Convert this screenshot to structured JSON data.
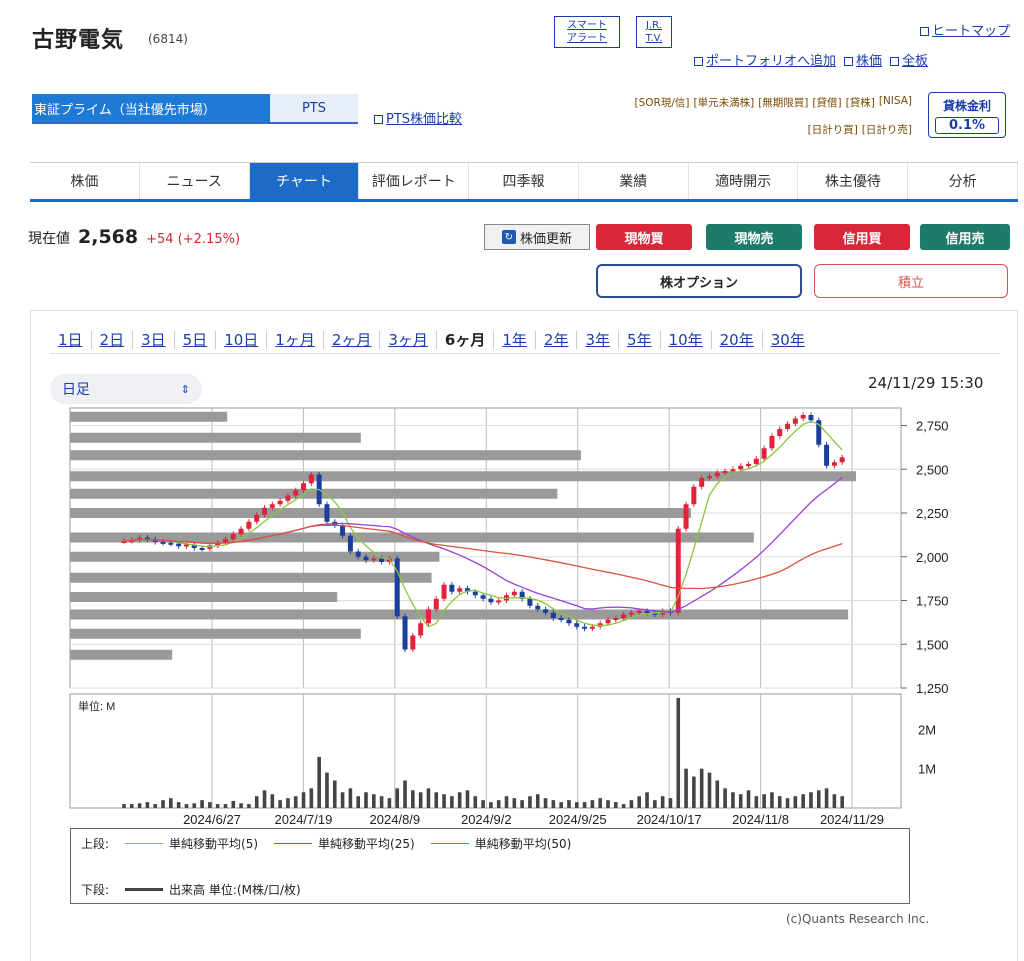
{
  "header": {
    "title": "古野電気",
    "code": "(6814)",
    "smart_alert_1": "スマート",
    "smart_alert_2": "アラート",
    "jrtv_1": "J.R.",
    "jrtv_2": "T.V.",
    "heatmap": "ヒートマップ",
    "portfolio_add": "ポートフォリオへ追加",
    "stock_price": "株価",
    "full_board": "全板"
  },
  "market": {
    "primary": "東証プライム（当社優先市場）",
    "pts": "PTS",
    "pts_compare": "PTS株価比較"
  },
  "tags": {
    "row1": [
      "[SOR現/信]",
      "[単元未満株]",
      "[無期限買]",
      "[貸借]",
      "[貸株]",
      "[NISA]"
    ],
    "row2": [
      "[日計り買]",
      "[日計り売]"
    ]
  },
  "lending": {
    "label": "貸株金利",
    "value": "0.1%"
  },
  "nav": {
    "tabs": [
      "株価",
      "ニュース",
      "チャート",
      "評価レポート",
      "四季報",
      "業績",
      "適時開示",
      "株主優待",
      "分析"
    ],
    "active_index": 2
  },
  "quote": {
    "label": "現在値",
    "price": "2,568",
    "change": "+54 (+2.15%)"
  },
  "actions": {
    "refresh": "株価更新",
    "cash_buy": "現物買",
    "cash_sell": "現物売",
    "margin_buy": "信用買",
    "margin_sell": "信用売",
    "option": "株オプション",
    "accumulate": "積立",
    "buy_color": "#d9273a",
    "sell_color": "#1e7a6a"
  },
  "periods": {
    "items": [
      "1日",
      "2日",
      "3日",
      "5日",
      "10日",
      "1ヶ月",
      "2ヶ月",
      "3ヶ月",
      "6ヶ月",
      "1年",
      "2年",
      "3年",
      "5年",
      "10年",
      "20年",
      "30年"
    ],
    "active_index": 8
  },
  "chart_controls": {
    "interval": "日足",
    "timestamp": "24/11/29 15:30",
    "volume_unit": "単位: M"
  },
  "chart_data": [
    {
      "type": "candlestick",
      "x_ticks": [
        "2024/6/27",
        "2024/7/19",
        "2024/8/9",
        "2024/9/2",
        "2024/9/25",
        "2024/10/17",
        "2024/11/8",
        "2024/11/29"
      ],
      "y_ticks": [
        "2,750",
        "2,500",
        "2,250",
        "2,000",
        "1,750",
        "1,500",
        "1,250"
      ],
      "ylim": [
        1250,
        2850
      ],
      "close": [
        2090,
        2095,
        2110,
        2100,
        2085,
        2080,
        2075,
        2060,
        2070,
        2050,
        2045,
        2065,
        2080,
        2100,
        2130,
        2160,
        2200,
        2240,
        2280,
        2300,
        2320,
        2350,
        2380,
        2420,
        2470,
        2300,
        2200,
        2180,
        2120,
        2030,
        2000,
        1980,
        1990,
        1970,
        1990,
        1660,
        1470,
        1550,
        1620,
        1700,
        1760,
        1840,
        1800,
        1820,
        1800,
        1780,
        1760,
        1740,
        1750,
        1780,
        1800,
        1760,
        1720,
        1700,
        1680,
        1650,
        1640,
        1620,
        1600,
        1590,
        1600,
        1620,
        1640,
        1650,
        1670,
        1680,
        1690,
        1680,
        1670,
        1690,
        1680,
        2160,
        2300,
        2400,
        2450,
        2460,
        2480,
        2490,
        2500,
        2520,
        2530,
        2560,
        2620,
        2690,
        2730,
        2760,
        2790,
        2810,
        2780,
        2640,
        2520,
        2540,
        2568
      ],
      "ma_colors": {
        "ma5": "#8cc63f",
        "ma25": "#9b3fd9",
        "ma50": "#e0503a"
      },
      "up_color": "#e0223a",
      "down_color": "#1c3f9e",
      "price_bands": [
        {
          "price": 2800,
          "width": 0.2
        },
        {
          "price": 2680,
          "width": 0.37
        },
        {
          "price": 2580,
          "width": 0.65
        },
        {
          "price": 2460,
          "width": 1.0
        },
        {
          "price": 2360,
          "width": 0.62
        },
        {
          "price": 2250,
          "width": 0.79
        },
        {
          "price": 2110,
          "width": 0.87
        },
        {
          "price": 2000,
          "width": 0.47
        },
        {
          "price": 1880,
          "width": 0.46
        },
        {
          "price": 1770,
          "width": 0.34
        },
        {
          "price": 1670,
          "width": 0.99
        },
        {
          "price": 1560,
          "width": 0.37
        },
        {
          "price": 1440,
          "width": 0.13
        }
      ]
    },
    {
      "type": "bar",
      "title": "単位: M",
      "y_ticks": [
        "2M",
        "1M"
      ],
      "ylim": [
        0,
        2.9
      ],
      "values": [
        0.1,
        0.1,
        0.12,
        0.15,
        0.1,
        0.2,
        0.25,
        0.15,
        0.1,
        0.12,
        0.2,
        0.15,
        0.1,
        0.1,
        0.18,
        0.12,
        0.1,
        0.3,
        0.45,
        0.35,
        0.2,
        0.25,
        0.3,
        0.4,
        0.5,
        1.3,
        0.9,
        0.7,
        0.4,
        0.5,
        0.3,
        0.4,
        0.35,
        0.3,
        0.25,
        0.5,
        0.7,
        0.45,
        0.4,
        0.5,
        0.4,
        0.35,
        0.3,
        0.4,
        0.45,
        0.3,
        0.2,
        0.15,
        0.2,
        0.3,
        0.25,
        0.2,
        0.3,
        0.35,
        0.25,
        0.2,
        0.15,
        0.2,
        0.15,
        0.15,
        0.2,
        0.25,
        0.2,
        0.15,
        0.1,
        0.2,
        0.3,
        0.4,
        0.2,
        0.3,
        0.25,
        2.8,
        1.0,
        0.8,
        1.0,
        0.9,
        0.7,
        0.5,
        0.4,
        0.35,
        0.45,
        0.3,
        0.35,
        0.4,
        0.3,
        0.25,
        0.3,
        0.35,
        0.4,
        0.45,
        0.5,
        0.35,
        0.3
      ],
      "color": "#444444"
    }
  ],
  "legend": {
    "upper_label": "上段:",
    "ma5": "単純移動平均(5)",
    "ma25": "単純移動平均(25)",
    "ma50": "単純移動平均(50)",
    "lower_label": "下段:",
    "volume": "出来高 単位:(M株/口/枚)"
  },
  "footer": {
    "copyright": "(c)Quants Research Inc."
  }
}
